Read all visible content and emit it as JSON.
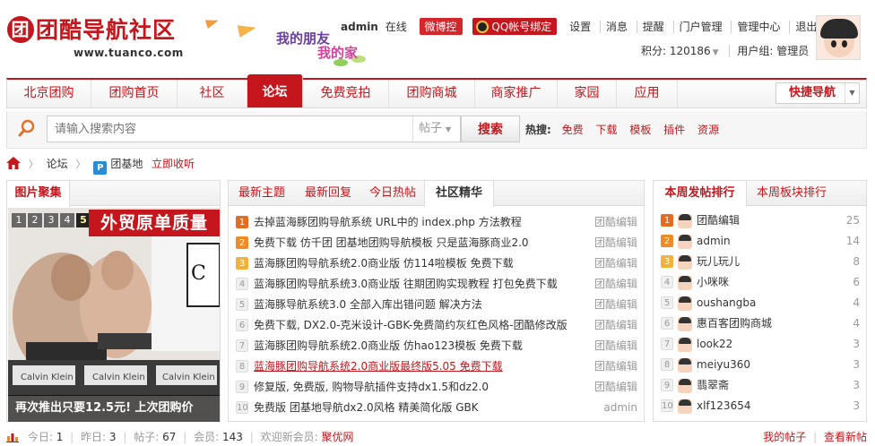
{
  "site": {
    "logo_text": "团酷导航社区",
    "logo_url": "www.tuanco.com",
    "banner_line1": "我的朋友",
    "banner_line2": "我的家"
  },
  "userbar": {
    "username": "admin",
    "status": "在线",
    "weibo_button": "微博控",
    "qq_button": "QQ帐号绑定",
    "links": [
      "设置",
      "消息",
      "提醒",
      "门户管理",
      "管理中心",
      "退出"
    ],
    "credits_label": "积分: 120186",
    "group_label": "用户组: 管理员"
  },
  "nav": {
    "items": [
      "北京团购",
      "团购首页",
      "社区",
      "论坛",
      "免费竞拍",
      "团购商城",
      "商家推广",
      "家园",
      "应用"
    ],
    "active": "论坛",
    "quick_nav": "快捷导航"
  },
  "search": {
    "placeholder": "请输入搜索内容",
    "type": "帖子",
    "button": "搜索",
    "hot_label": "热搜:",
    "hot_keywords": [
      "免费",
      "下载",
      "模板",
      "插件",
      "资源"
    ]
  },
  "breadcrumb": {
    "forum": "论坛",
    "board": "团基地",
    "favorite": "立即收听"
  },
  "gallery": {
    "title": "图片聚集",
    "dots": [
      "1",
      "2",
      "3",
      "4",
      "5"
    ],
    "active_dot": "5",
    "banner_text": "外贸原单质量",
    "caption": "再次推出只要12.5元! 上次团购价"
  },
  "threads": {
    "tabs": [
      "最新主题",
      "最新回复",
      "今日热帖",
      "社区精华"
    ],
    "active_tab": "社区精华",
    "rows": [
      {
        "num": "1",
        "title": "去掉蓝海豚团购导航系统 URL中的 index.php 方法教程",
        "author": "团酷编辑"
      },
      {
        "num": "2",
        "title": "免费下载 仿千团 团基地团购导航模板 只是蓝海豚商业2.0",
        "author": "团酷编辑"
      },
      {
        "num": "3",
        "title": "蓝海豚团购导航系统2.0商业版 仿114啦模板 免费下载",
        "author": "团酷编辑"
      },
      {
        "num": "4",
        "title": "蓝海豚团购导航系统3.0商业版 往期团购实现教程 打包免费下载",
        "author": "团酷编辑"
      },
      {
        "num": "5",
        "title": "蓝海豚导航系统3.0 全部入库出错问题 解决方法",
        "author": "团酷编辑"
      },
      {
        "num": "6",
        "title": "免费下载, DX2.0-克米设计-GBK-免费简约灰红色风格-团酷修改版",
        "author": "团酷编辑"
      },
      {
        "num": "7",
        "title": "蓝海豚团购导航系统2.0商业版 仿hao123模板 免费下载",
        "author": "团酷编辑"
      },
      {
        "num": "8",
        "title": "蓝海豚团购导航系统2.0商业版最终版5.05 免费下载",
        "author": "团酷编辑"
      },
      {
        "num": "9",
        "title": "修复版, 免费版, 购物导航插件支持dx1.5和dz2.0",
        "author": "团酷编辑"
      },
      {
        "num": "10",
        "title": "免费版 团基地导航dx2.0风格 精美简化版 GBK",
        "author": "admin"
      }
    ],
    "highlight_index": 7
  },
  "rank": {
    "tabs": [
      "本周发帖排行",
      "本周板块排行"
    ],
    "active_tab": "本周发帖排行",
    "rows": [
      {
        "num": "1",
        "name": "团酷编辑",
        "count": "25"
      },
      {
        "num": "2",
        "name": "admin",
        "count": "14"
      },
      {
        "num": "3",
        "name": "玩儿玩儿",
        "count": "8"
      },
      {
        "num": "4",
        "name": "小咪咪",
        "count": "6"
      },
      {
        "num": "5",
        "name": "oushangba",
        "count": "4"
      },
      {
        "num": "6",
        "name": "惠百客团购商城",
        "count": "4"
      },
      {
        "num": "7",
        "name": "look22",
        "count": "3"
      },
      {
        "num": "8",
        "name": "meiyu360",
        "count": "3"
      },
      {
        "num": "9",
        "name": "翡翠斋",
        "count": "3"
      },
      {
        "num": "10",
        "name": "xlf123654",
        "count": "3"
      }
    ]
  },
  "stats": {
    "today_label": "今日:",
    "today": "1",
    "yesterday_label": "昨日:",
    "yesterday": "3",
    "posts_label": "帖子:",
    "posts": "67",
    "members_label": "会员:",
    "members": "143",
    "welcome_label": "欢迎新会员:",
    "new_member": "聚优网",
    "my_posts": "我的帖子",
    "view_new": "查看新帖"
  },
  "colors": {
    "brand_red": "#c4161c",
    "muted_text": "#999999"
  }
}
